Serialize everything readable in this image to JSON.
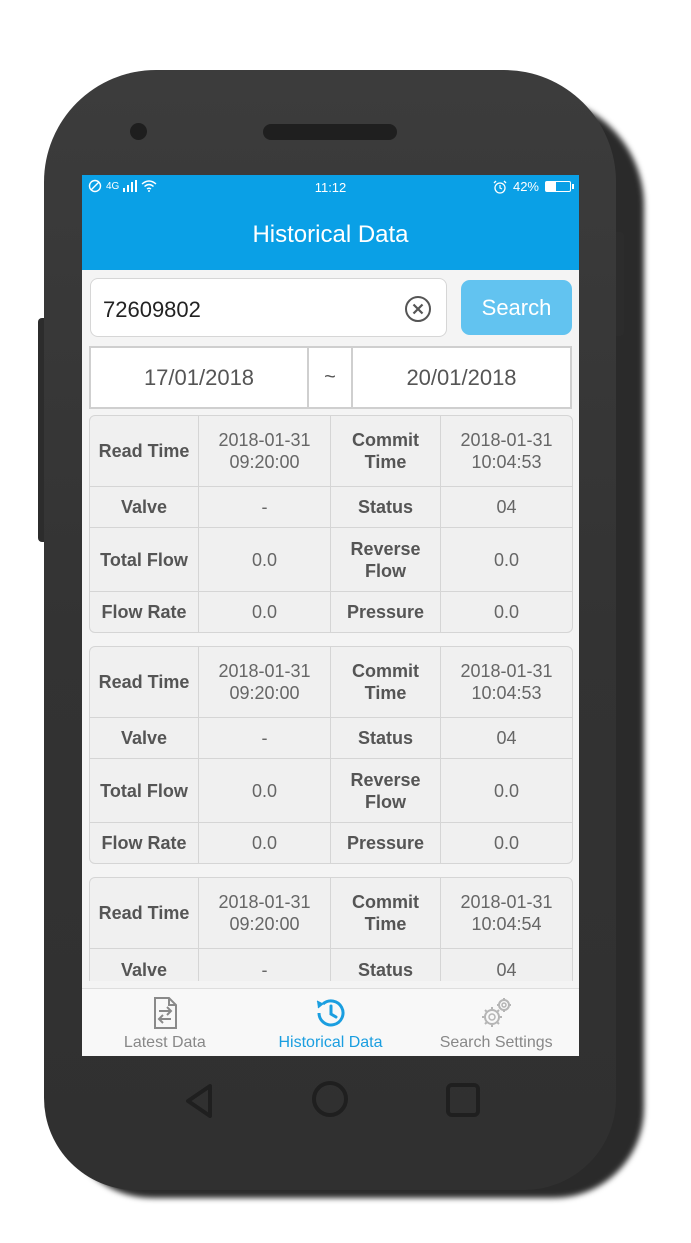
{
  "status_bar": {
    "carrier_text": "4G",
    "time": "11:12",
    "battery_percent": "42%",
    "battery_level": 0.42,
    "icons": [
      "no-disturb-icon",
      "signal-icon",
      "wifi-icon",
      "alarm-icon",
      "battery-icon"
    ]
  },
  "header": {
    "title": "Historical Data"
  },
  "search": {
    "value": "72609802",
    "button_label": "Search"
  },
  "date_range": {
    "from": "17/01/2018",
    "separator": "~",
    "to": "20/01/2018"
  },
  "records": [
    {
      "read_time_label": "Read Time",
      "read_time_date": "2018-01-31",
      "read_time_clock": "09:20:00",
      "commit_time_label_1": "Commit",
      "commit_time_label_2": "Time",
      "commit_time_date": "2018-01-31",
      "commit_time_clock": "10:04:53",
      "valve_label": "Valve",
      "valve_value": "-",
      "status_label": "Status",
      "status_value": "04",
      "total_flow_label": "Total Flow",
      "total_flow_value": "0.0",
      "reverse_flow_label_1": "Reverse",
      "reverse_flow_label_2": "Flow",
      "reverse_flow_value": "0.0",
      "flow_rate_label": "Flow Rate",
      "flow_rate_value": "0.0",
      "pressure_label": "Pressure",
      "pressure_value": "0.0"
    },
    {
      "read_time_label": "Read Time",
      "read_time_date": "2018-01-31",
      "read_time_clock": "09:20:00",
      "commit_time_label_1": "Commit",
      "commit_time_label_2": "Time",
      "commit_time_date": "2018-01-31",
      "commit_time_clock": "10:04:53",
      "valve_label": "Valve",
      "valve_value": "-",
      "status_label": "Status",
      "status_value": "04",
      "total_flow_label": "Total Flow",
      "total_flow_value": "0.0",
      "reverse_flow_label_1": "Reverse",
      "reverse_flow_label_2": "Flow",
      "reverse_flow_value": "0.0",
      "flow_rate_label": "Flow Rate",
      "flow_rate_value": "0.0",
      "pressure_label": "Pressure",
      "pressure_value": "0.0"
    },
    {
      "read_time_label": "Read Time",
      "read_time_date": "2018-01-31",
      "read_time_clock": "09:20:00",
      "commit_time_label_1": "Commit",
      "commit_time_label_2": "Time",
      "commit_time_date": "2018-01-31",
      "commit_time_clock": "10:04:54",
      "valve_label": "Valve",
      "valve_value": "-",
      "status_label": "Status",
      "status_value": "04"
    }
  ],
  "tabs": [
    {
      "label": "Latest Data",
      "icon": "data-transfer-icon",
      "active": false
    },
    {
      "label": "Historical Data",
      "icon": "history-clock-icon",
      "active": true
    },
    {
      "label": "Search Settings",
      "icon": "gears-icon",
      "active": false
    }
  ],
  "colors": {
    "accent": "#0aa0e6",
    "search_button": "#62c3f0",
    "active_tab": "#1a9ee0",
    "inactive_tab": "#888888"
  }
}
